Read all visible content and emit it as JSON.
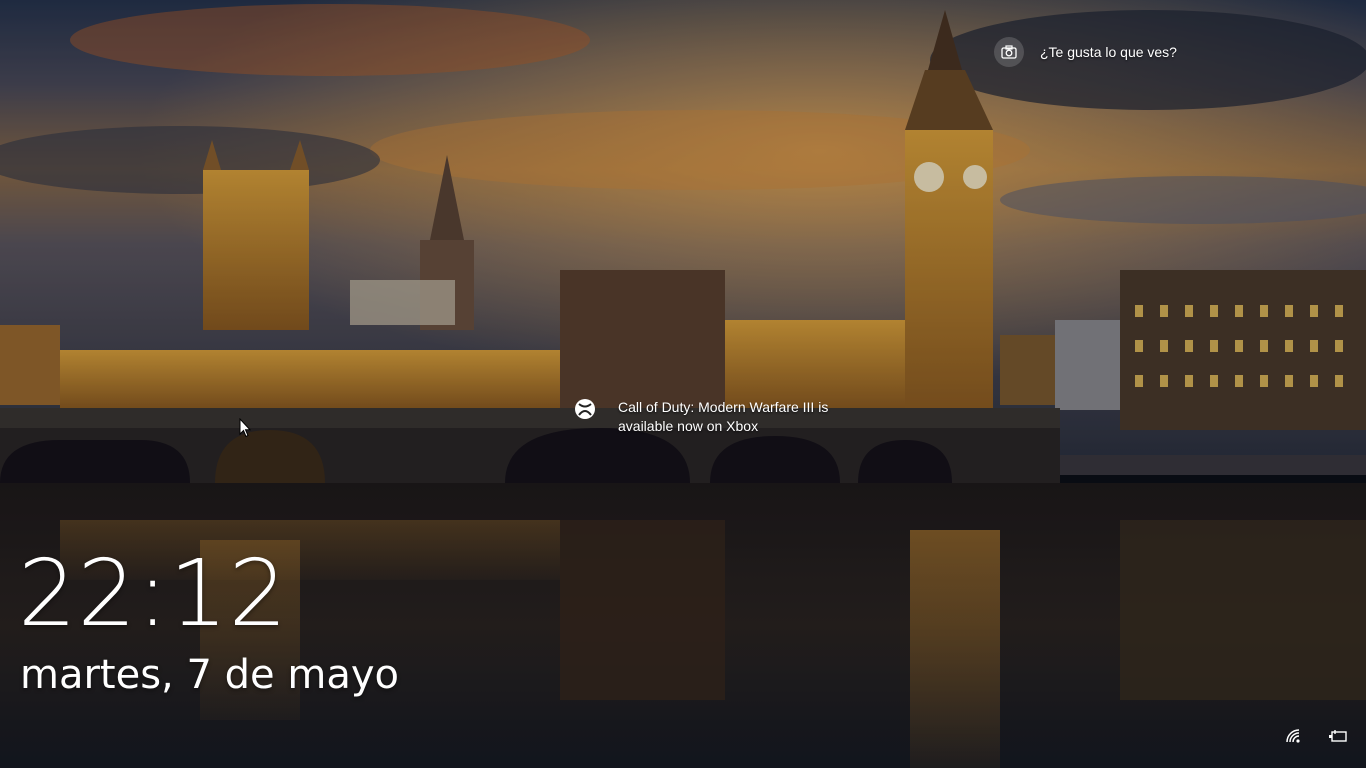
{
  "spotlight": {
    "label": "¿Te gusta lo que ves?",
    "icon": "camera-icon"
  },
  "promo": {
    "icon": "xbox-icon",
    "text": "Call of Duty: Modern Warfare III is available now on Xbox"
  },
  "lockscreen": {
    "time": "22:12",
    "date": "martes, 7 de mayo"
  },
  "tray": {
    "network_icon": "wifi-icon",
    "battery_icon": "battery-icon"
  },
  "colors": {
    "sky_top": "#2a3a58",
    "sunset": "#c7702e",
    "building_lights": "#e2a93a",
    "water": "#141216"
  }
}
